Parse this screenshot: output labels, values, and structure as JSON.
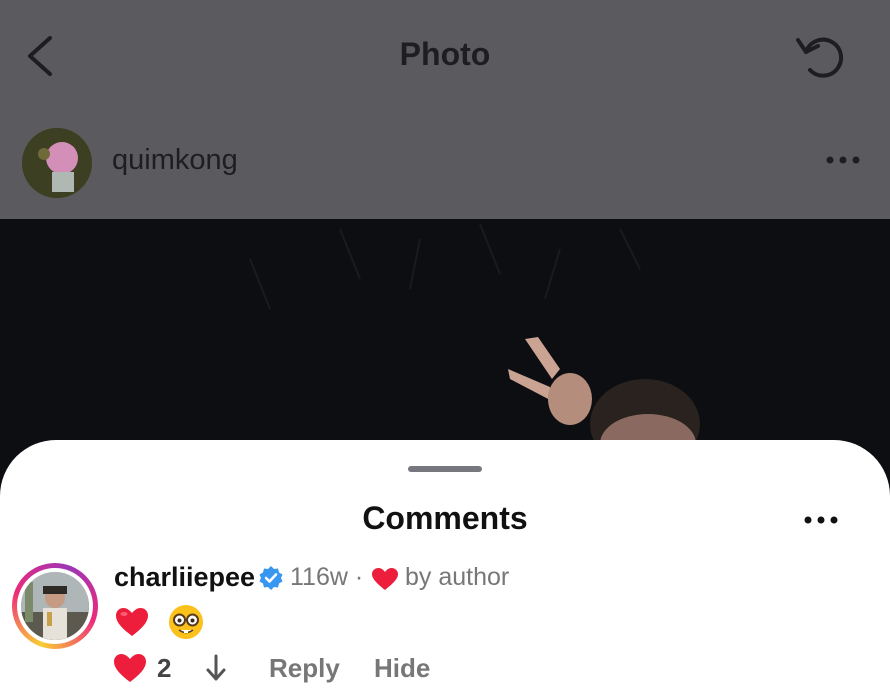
{
  "header": {
    "title": "Photo",
    "back_icon": "chevron-left-icon",
    "refresh_icon": "refresh-icon"
  },
  "post": {
    "author": "quimkong",
    "more_icon": "more-horizontal-icon"
  },
  "comments_sheet": {
    "title": "Comments",
    "more_icon": "more-horizontal-icon",
    "comment": {
      "username": "charliiepee",
      "verified": true,
      "age": "116w ·",
      "liked_by_author": "by author",
      "body_emojis": [
        "heart-emoji",
        "nerd-face-emoji"
      ],
      "like_count": "2",
      "reply_label": "Reply",
      "hide_label": "Hide"
    }
  },
  "colors": {
    "heart_red": "#ed1d3c",
    "verified_blue": "#3897f0",
    "dim_overlay": "#5b5b5f"
  }
}
